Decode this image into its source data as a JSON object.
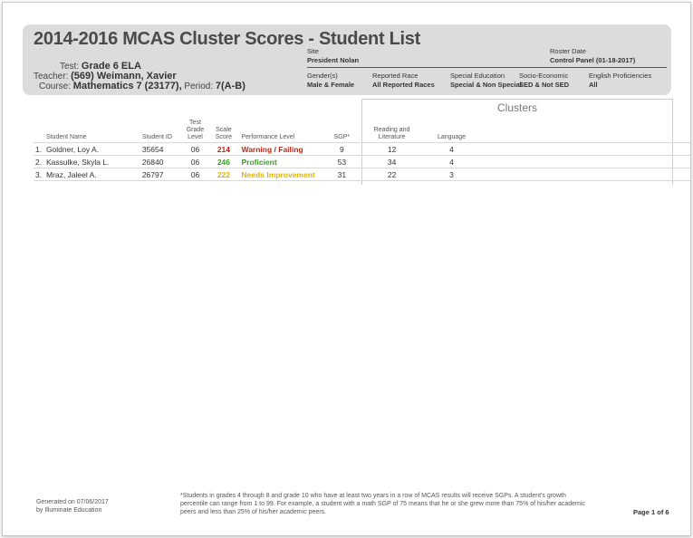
{
  "report": {
    "title": "2014-2016 MCAS Cluster Scores - Student List",
    "test_label": "Test:",
    "test_value": "Grade 6 ELA",
    "teacher_label": "Teacher:",
    "teacher_value": "(569) Weimann, Xavier",
    "course_label": "Course:",
    "course_value": "Mathematics 7 (23177),",
    "period_label": "Period:",
    "period_value": "7(A-B)"
  },
  "filters": {
    "site_label": "Site",
    "site_value": "President Nolan",
    "roster_label": "Roster Date",
    "roster_value": "Control Panel (01-18-2017)",
    "gender_label": "Gender(s)",
    "gender_value": "Male & Female",
    "race_label": "Reported Race",
    "race_value": "All Reported Races",
    "sped_label": "Special Education",
    "sped_value": "Special & Non Special",
    "ses_label": "Socio-Economic",
    "ses_value": "SED & Not SED",
    "ell_label": "English Proficiencies",
    "ell_value": "All"
  },
  "table": {
    "clusters_title": "Clusters",
    "headers": {
      "name": "Student Name",
      "id": "Student ID",
      "grade_l1": "Test",
      "grade_l2": "Grade",
      "grade_l3": "Level",
      "scale": "Scale Score",
      "perf": "Performance Level",
      "sgp": "SGP*",
      "rl_l1": "Reading and",
      "rl_l2": "Literature",
      "lang": "Language"
    },
    "rows": [
      {
        "num": "1.",
        "name": "Goldner, Loy A.",
        "id": "35654",
        "grade": "06",
        "score": "214",
        "perf": "Warning / Failing",
        "sgp": "9",
        "rl": "12",
        "lang": "4"
      },
      {
        "num": "2.",
        "name": "Kassulke, Skyla L.",
        "id": "26840",
        "grade": "06",
        "score": "246",
        "perf": "Proficient",
        "sgp": "53",
        "rl": "34",
        "lang": "4"
      },
      {
        "num": "3.",
        "name": "Mraz, Jaleel A.",
        "id": "26797",
        "grade": "06",
        "score": "222",
        "perf": "Needs Improvement",
        "sgp": "31",
        "rl": "22",
        "lang": "3"
      }
    ]
  },
  "footer": {
    "generated_line1": "Generated on 07/06/2017",
    "generated_line2": "by Illuminate Education",
    "note_line1": "*Students in grades 4 through 8 and grade 10 who have at least two years in a row of MCAS results will receive SGPs. A student's growth",
    "note_line2": "percentile can range from 1 to 99. For example, a student with a math SGP of 75 means that he or she grew more than 75% of his/her academic",
    "note_line3": "peers and less than 25% of his/her academic peers.",
    "page": "Page 1 of 6"
  },
  "colors": {
    "warning": "#c0261a",
    "proficient": "#3d9a28",
    "needs_improvement": "#e0b400",
    "header_bg": "#dcdcdc"
  }
}
